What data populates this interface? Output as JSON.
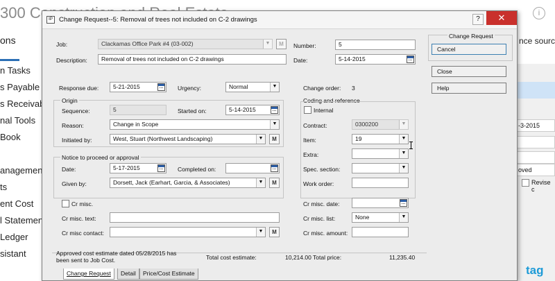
{
  "background": {
    "app_title": "300 Construction and Real Estate",
    "tab_label": "ons",
    "nav_items": [
      "n Tasks",
      "s Payable",
      "s Receivab",
      "nal Tools",
      "Book",
      "",
      "anagement",
      "ts",
      "ent Cost",
      "l Statemen",
      "Ledger",
      "sistant"
    ],
    "right_source": "nce source",
    "right_info": "i",
    "right_date": "-3-2015",
    "right_status": "oved",
    "right_check_label": "Revise c",
    "logo": "tag"
  },
  "dialog": {
    "icon_text": "IP",
    "title": "Change Request--5: Removal of trees not included on C-2 drawings",
    "help_glyph": "?",
    "close_glyph": "✕"
  },
  "form": {
    "job_label": "Job:",
    "job_value": "Clackamas Office Park #4 (03-002)",
    "description_label": "Description:",
    "description_value": "Removal of trees not included on C-2 drawings",
    "number_label": "Number:",
    "number_value": "5",
    "date_label": "Date:",
    "date_value": "5-14-2015",
    "response_due_label": "Response due:",
    "response_due_value": "5-21-2015",
    "urgency_label": "Urgency:",
    "urgency_value": "Normal",
    "change_order_label": "Change order:",
    "change_order_value": "3",
    "origin_group": "Origin",
    "sequence_label": "Sequence:",
    "sequence_value": "5",
    "started_on_label": "Started on:",
    "started_on_value": "5-14-2015",
    "reason_label": "Reason:",
    "reason_value": "Change in Scope",
    "initiated_by_label": "Initiated by:",
    "initiated_by_value": "West, Stuart (Northwest Landscaping)",
    "notice_group": "Notice to proceed or approval",
    "notice_date_label": "Date:",
    "notice_date_value": "5-17-2015",
    "completed_on_label": "Completed on:",
    "completed_on_value": "",
    "given_by_label": "Given by:",
    "given_by_value": "Dorsett, Jack (Earhart, Garcia, & Associates)",
    "coding_group": "Coding and reference",
    "internal_label": "Internal",
    "contract_label": "Contract:",
    "contract_value": "0300200",
    "item_label": "Item:",
    "item_value": "19",
    "extra_label": "Extra:",
    "extra_value": "",
    "spec_section_label": "Spec. section:",
    "spec_section_value": "",
    "work_order_label": "Work order:",
    "work_order_value": "",
    "cr_misc_label": "Cr misc.",
    "cr_misc_text_label": "Cr misc. text:",
    "cr_misc_contact_label": "Cr misc contact:",
    "cr_misc_date_label": "Cr misc. date:",
    "cr_misc_list_label": "Cr misc. list:",
    "cr_misc_list_value": "None",
    "cr_misc_amount_label": "Cr misc. amount:",
    "approved_note": "Approved cost estimate dated 05/28/2015 has been sent to Job Cost.",
    "total_cost_label": "Total cost estimate:",
    "total_cost_value": "10,214.00",
    "total_price_label": "Total price:",
    "total_price_value": "11,235.40"
  },
  "side": {
    "title": "Change Request",
    "cancel_label": "Cancel",
    "close_label": "Close",
    "help_label": "Help"
  },
  "tabs": [
    "Change Request",
    "Detail",
    "Price/Cost Estimate"
  ],
  "glyphs": {
    "dropdown": "▼",
    "lookup": "M"
  }
}
